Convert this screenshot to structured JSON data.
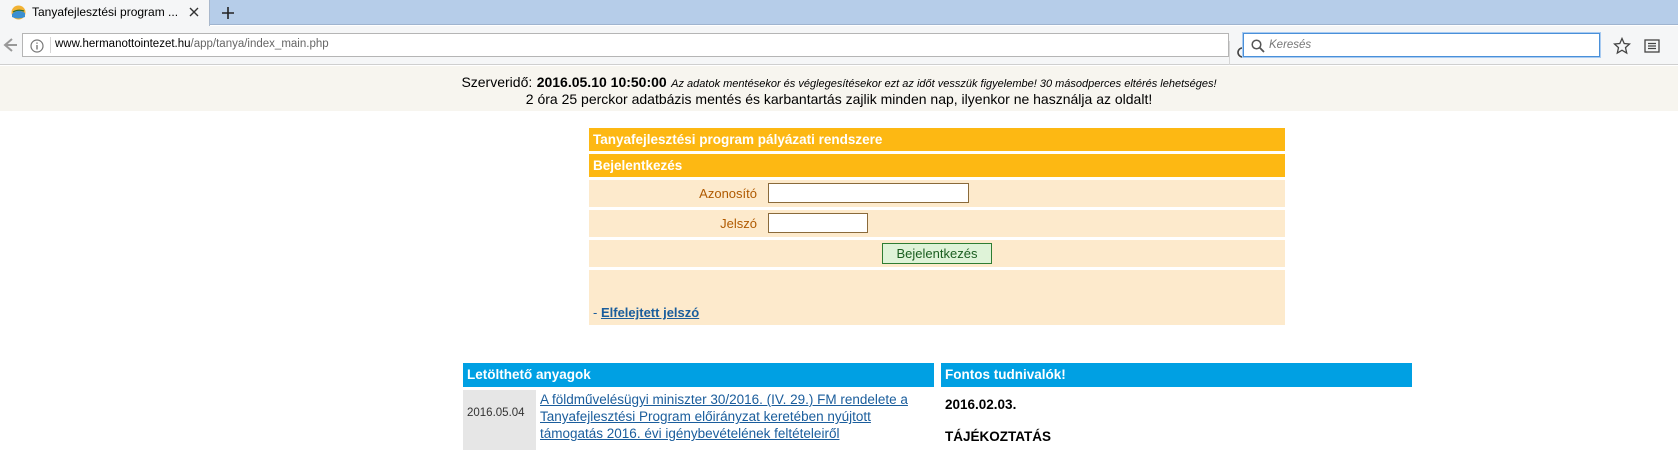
{
  "browser": {
    "tab_title": "Tanyafejlesztési program ...",
    "url_host": "www.hermanottointezet.hu",
    "url_path": "/app/tanya/index_main.php",
    "search_placeholder": "Keresés"
  },
  "server": {
    "label": "Szerveridő:",
    "time": "2016.05.10 10:50:00",
    "note": "Az adatok mentésekor és véglegesítésekor ezt az időt vesszük figyelembe! 30 másodperces eltérés lehetséges!",
    "maintenance": "2 óra 25 perckor adatbázis mentés és karbantartás zajlik minden nap, ilyenkor ne használja az oldalt!"
  },
  "login": {
    "system_title": "Tanyafejlesztési program pályázati rendszere",
    "section_title": "Bejelentkezés",
    "username_label": "Azonosító",
    "username_value": "",
    "password_label": "Jelszó",
    "password_value": "",
    "submit_label": "Bejelentkezés",
    "forgot_prefix": "- ",
    "forgot_label": "Elfelejtett jelszó"
  },
  "downloads": {
    "title": "Letölthető anyagok",
    "items": [
      {
        "date": "2016.05.04",
        "text": "A földművelésügyi miniszter 30/2016. (IV. 29.) FM rendelete a Tanyafejlesztési Program előirányzat keretében nyújtott támogatás 2016. évi igénybevételének feltételeiről"
      }
    ]
  },
  "news": {
    "title": "Fontos tudnivalók!",
    "date": "2016.02.03.",
    "headline": "TÁJÉKOZTATÁS"
  },
  "colors": {
    "accent_orange": "#fdb813",
    "accent_blue": "#00a0e3",
    "form_bg": "#fdeacc",
    "link": "#1a5d9c"
  }
}
